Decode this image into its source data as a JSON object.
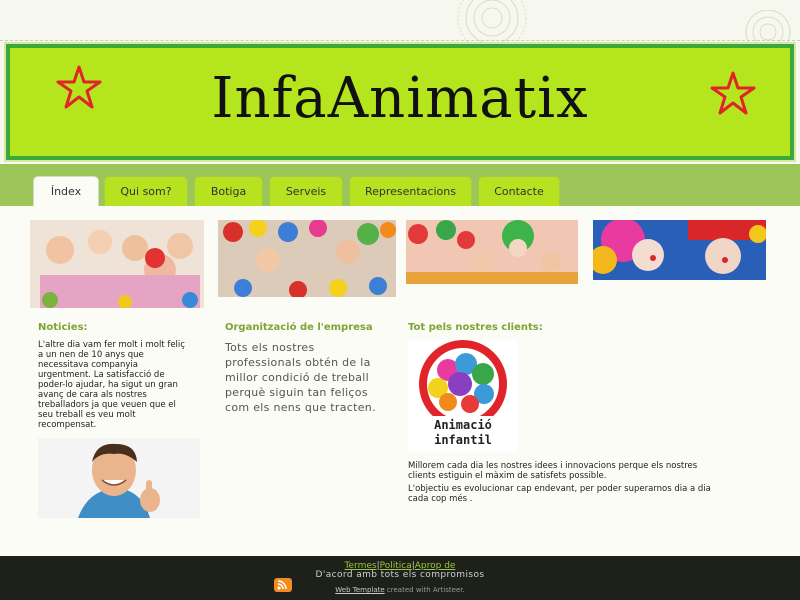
{
  "site": {
    "title": "InfaAnimatix"
  },
  "nav": {
    "tabs": [
      {
        "label": "Índex",
        "active": true
      },
      {
        "label": "Qui som?",
        "active": false
      },
      {
        "label": "Botiga",
        "active": false
      },
      {
        "label": "Serveis",
        "active": false
      },
      {
        "label": "Representacions",
        "active": false
      },
      {
        "label": "Contacte",
        "active": false
      }
    ]
  },
  "columns": {
    "news": {
      "title": "Noticies:",
      "lines": [
        "L'altre dia vam fer molt i molt feliç",
        "a un nen de 10 anys que",
        "necessitava companyia",
        "urgentment. La satisfacció de",
        "poder-lo ajudar, ha sigut un gran",
        "avanç de cara als nostres",
        "treballadors ja que veuen que el",
        "seu treball es veu molt",
        "recompensat."
      ]
    },
    "org": {
      "title": "Organització de l'empresa",
      "lines": [
        "Tots els nostres",
        "professionals obtén de la",
        "millor condició de treball",
        "perquè siguin tan feliços",
        "com els nens que tracten."
      ]
    },
    "clients": {
      "title": "Tot pels nostres clients:",
      "logo_text": [
        "Animació",
        "infantil"
      ],
      "para1": [
        "Millorem cada dia les nostres idees i innovacions perque els nostres",
        "clients estiguin el màxim de satisfets possible."
      ],
      "para2": [
        "L'objectiu es evolucionar cap endevant, per poder superarnos dia a dia",
        "cada cop més ."
      ]
    }
  },
  "footer": {
    "link_termes": "Termes",
    "link_politica": "Politica",
    "link_aprop": "Aprop de",
    "separator": "|",
    "tagline": "D'acord amb tots els compromisos",
    "credit_link": "Web Template",
    "credit_rest": " created with Artisteer."
  },
  "colors": {
    "header_bg": "#b5e61d",
    "header_border": "#3aa83a",
    "tab_bg": "#b6e21f",
    "section_title": "#7da434",
    "footer_bg": "#1e211a",
    "star": "#e0242a"
  },
  "icons": {
    "header_left": "star-icon",
    "header_right": "star-icon",
    "footer": "rss-icon"
  }
}
